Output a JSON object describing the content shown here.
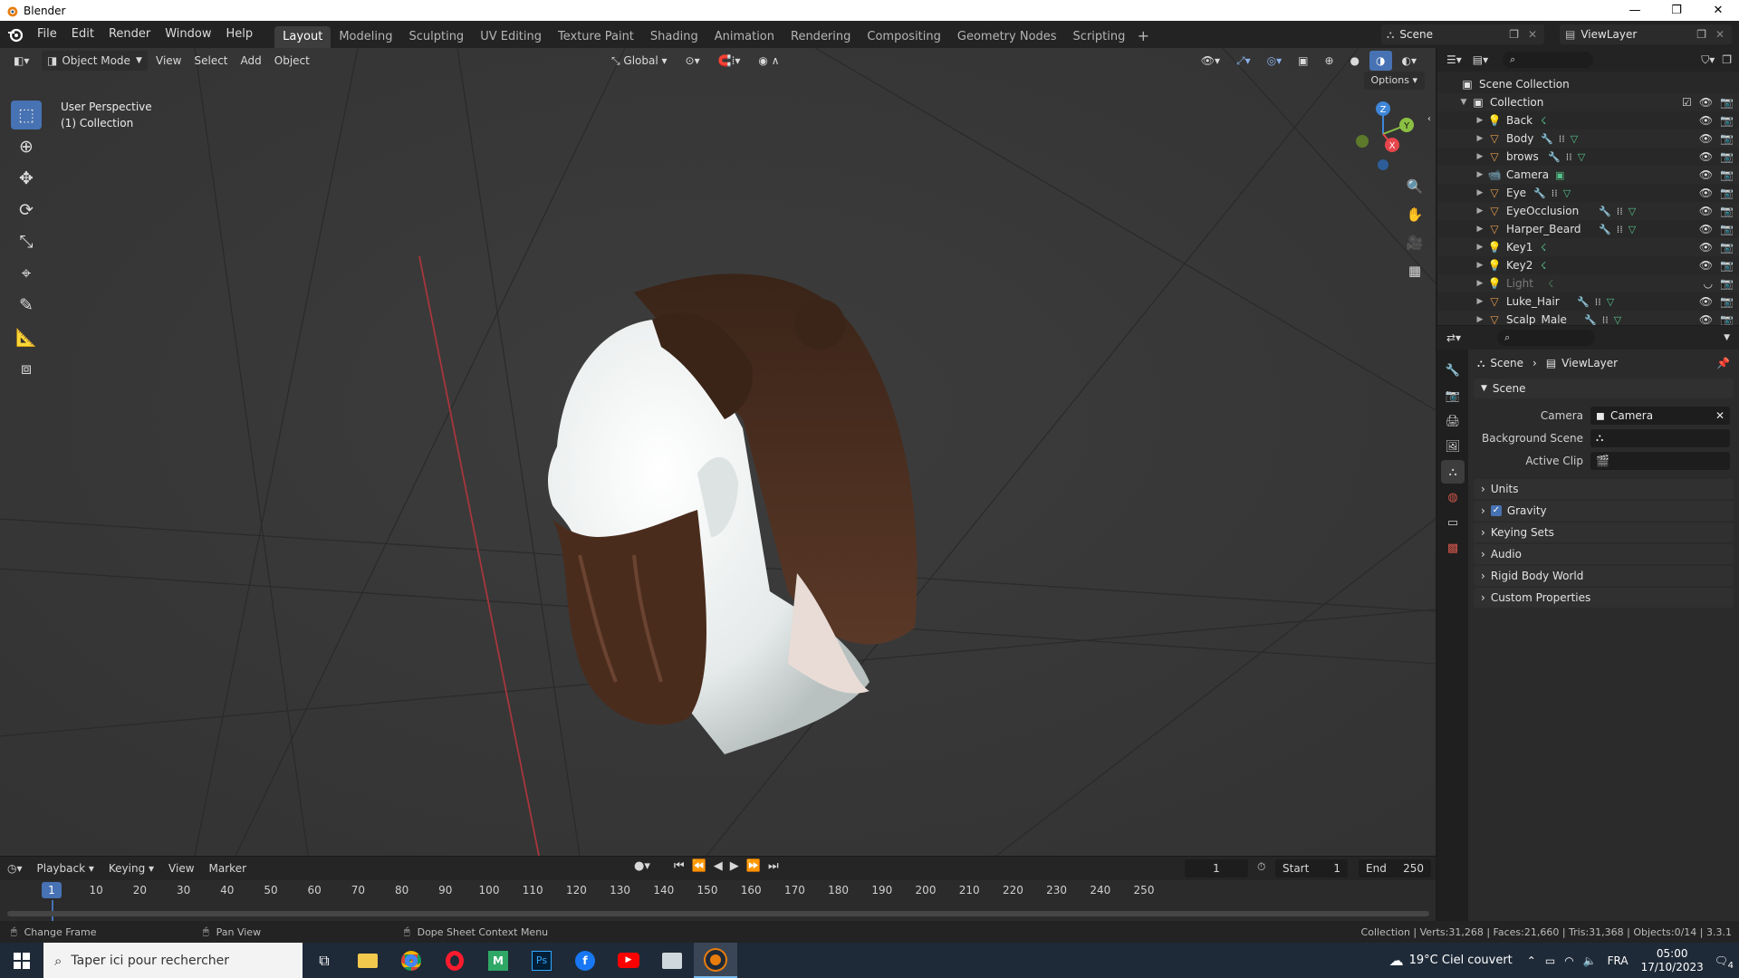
{
  "window": {
    "title": "Blender",
    "buttons": [
      "—",
      "❐",
      "✕"
    ]
  },
  "menus": [
    "File",
    "Edit",
    "Render",
    "Window",
    "Help"
  ],
  "workspaces": [
    "Layout",
    "Modeling",
    "Sculpting",
    "UV Editing",
    "Texture Paint",
    "Shading",
    "Animation",
    "Rendering",
    "Compositing",
    "Geometry Nodes",
    "Scripting"
  ],
  "active_workspace": "Layout",
  "scene_name": "Scene",
  "view_layer": "ViewLayer",
  "viewport": {
    "mode": "Object Mode",
    "menus": [
      "View",
      "Select",
      "Add",
      "Object"
    ],
    "transform_orientation": "Global",
    "options_label": "Options",
    "info_line1": "User Perspective",
    "info_line2": "(1) Collection",
    "gizmo": {
      "z": "Z",
      "y": "Y",
      "x": "X"
    }
  },
  "timeline": {
    "menus": [
      "Playback",
      "Keying",
      "View",
      "Marker"
    ],
    "current_frame": "1",
    "start_label": "Start",
    "start": "1",
    "end_label": "End",
    "end": "250",
    "ticks": [
      "10",
      "20",
      "30",
      "40",
      "50",
      "60",
      "70",
      "80",
      "90",
      "100",
      "110",
      "120",
      "130",
      "140",
      "150",
      "160",
      "170",
      "180",
      "190",
      "200",
      "210",
      "220",
      "230",
      "240",
      "250"
    ],
    "playhead": "1"
  },
  "status": {
    "left1": "Change Frame",
    "left2": "Pan View",
    "left3": "Dope Sheet Context Menu",
    "right": "Collection | Verts:31,268 | Faces:21,660 | Tris:31,368 | Objects:0/14 | 3.3.1"
  },
  "outliner": {
    "root": "Scene Collection",
    "collection": "Collection",
    "items": [
      {
        "name": "Back",
        "type": "light",
        "dim": false
      },
      {
        "name": "Body",
        "type": "mesh",
        "dim": false
      },
      {
        "name": "brows",
        "type": "mesh",
        "dim": false
      },
      {
        "name": "Camera",
        "type": "camera",
        "dim": false
      },
      {
        "name": "Eye",
        "type": "mesh",
        "dim": false
      },
      {
        "name": "EyeOcclusion",
        "type": "mesh",
        "dim": false
      },
      {
        "name": "Harper_Beard",
        "type": "mesh",
        "dim": false
      },
      {
        "name": "Key1",
        "type": "light",
        "dim": false
      },
      {
        "name": "Key2",
        "type": "light",
        "dim": false
      },
      {
        "name": "Light",
        "type": "light",
        "dim": true
      },
      {
        "name": "Luke_Hair",
        "type": "mesh",
        "dim": false
      },
      {
        "name": "Scalp_Male",
        "type": "mesh",
        "dim": false
      }
    ]
  },
  "properties": {
    "breadcrumb_scene": "Scene",
    "breadcrumb_viewlayer": "ViewLayer",
    "panel_title": "Scene",
    "camera_label": "Camera",
    "camera_value": "Camera",
    "background_scene_label": "Background Scene",
    "active_clip_label": "Active Clip",
    "panels": [
      "Units",
      "Gravity",
      "Keying Sets",
      "Audio",
      "Rigid Body World",
      "Custom Properties"
    ]
  },
  "taskbar": {
    "search_placeholder": "Taper ici pour rechercher",
    "weather": "19°C  Ciel couvert",
    "lang": "FRA",
    "time": "05:00",
    "date": "17/10/2023",
    "notifications": "4"
  },
  "colors": {
    "accent": "#4772b3",
    "viewport_bg": "#393939",
    "x_axis": "#e6454c",
    "y_axis": "#8bc043",
    "z_axis": "#3e86d8"
  }
}
